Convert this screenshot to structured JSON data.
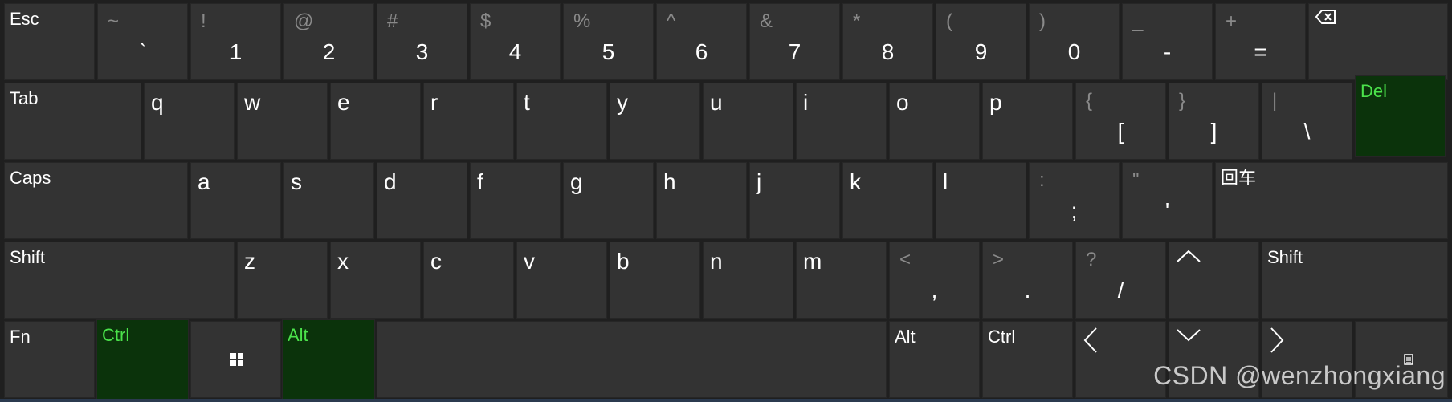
{
  "colors": {
    "background": "#1f1f1f",
    "key": "#333333",
    "active_key": "#0b330b",
    "active_label": "#4be34b",
    "secondary_char": "#8a8a8a"
  },
  "row1": {
    "esc": "Esc",
    "keys": [
      {
        "shift": "~",
        "main": "`"
      },
      {
        "shift": "!",
        "main": "1"
      },
      {
        "shift": "@",
        "main": "2"
      },
      {
        "shift": "#",
        "main": "3"
      },
      {
        "shift": "$",
        "main": "4"
      },
      {
        "shift": "%",
        "main": "5"
      },
      {
        "shift": "^",
        "main": "6"
      },
      {
        "shift": "&",
        "main": "7"
      },
      {
        "shift": "*",
        "main": "8"
      },
      {
        "shift": "(",
        "main": "9"
      },
      {
        "shift": ")",
        "main": "0"
      },
      {
        "shift": "_",
        "main": "-"
      },
      {
        "shift": "+",
        "main": "="
      }
    ],
    "backspace_icon": "backspace-icon"
  },
  "row2": {
    "tab": "Tab",
    "letters": [
      "q",
      "w",
      "e",
      "r",
      "t",
      "y",
      "u",
      "i",
      "o",
      "p"
    ],
    "symbols": [
      {
        "shift": "{",
        "main": "["
      },
      {
        "shift": "}",
        "main": "]"
      },
      {
        "shift": "|",
        "main": "\\"
      }
    ],
    "del": "Del"
  },
  "row3": {
    "caps": "Caps",
    "letters": [
      "a",
      "s",
      "d",
      "f",
      "g",
      "h",
      "j",
      "k",
      "l"
    ],
    "symbols": [
      {
        "shift": ":",
        "main": ";"
      },
      {
        "shift": "\"",
        "main": "'"
      }
    ],
    "enter": "回车"
  },
  "row4": {
    "shift_left": "Shift",
    "letters": [
      "z",
      "x",
      "c",
      "v",
      "b",
      "n",
      "m"
    ],
    "symbols": [
      {
        "shift": "<",
        "main": ","
      },
      {
        "shift": ">",
        "main": "."
      },
      {
        "shift": "?",
        "main": "/"
      }
    ],
    "up_icon": "arrow-up-icon",
    "shift_right": "Shift"
  },
  "row5": {
    "fn": "Fn",
    "ctrl_left": "Ctrl",
    "win_icon": "windows-icon",
    "alt_left": "Alt",
    "alt_right": "Alt",
    "ctrl_right": "Ctrl",
    "left_icon": "arrow-left-icon",
    "down_icon": "arrow-down-icon",
    "right_icon": "arrow-right-icon",
    "menu_icon": "context-menu-icon"
  },
  "watermark": "CSDN @wenzhongxiang"
}
